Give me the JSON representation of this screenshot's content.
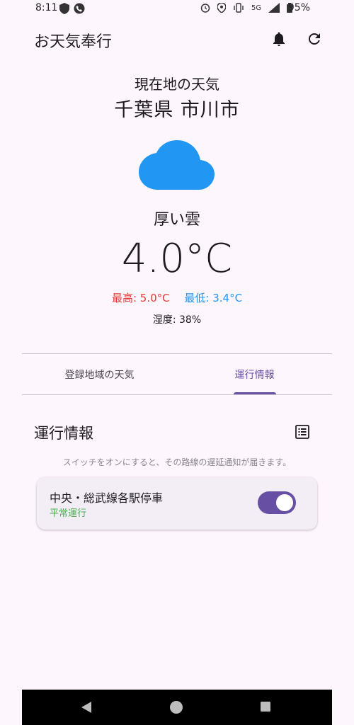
{
  "status_bar": {
    "time": "8:11",
    "network": "5G",
    "battery": "95%",
    "icons": [
      "shield-icon",
      "phone-icon",
      "alarm-icon",
      "location-icon",
      "vibrate-icon",
      "signal-icon",
      "battery-icon"
    ]
  },
  "app_bar": {
    "title": "お天気奉行",
    "icons": [
      "bell-icon",
      "refresh-icon"
    ]
  },
  "weather": {
    "location_label": "現在地の天気",
    "location": "千葉県 市川市",
    "condition": "厚い雲",
    "temperature": "4.0°C",
    "high": "最高: 5.0°C",
    "low": "最低: 3.4°C",
    "humidity": "湿度: 38%",
    "colors": {
      "high": "#e53935",
      "low": "#2196f3",
      "cloud": "#2196f3"
    }
  },
  "tabs": [
    {
      "label": "登録地域の天気",
      "selected": false
    },
    {
      "label": "運行情報",
      "selected": true
    }
  ],
  "service": {
    "title": "運行情報",
    "hint": "スイッチをオンにすると、その路線の遅延通知が届きます。",
    "lines": [
      {
        "name": "中央・総武線各駅停車",
        "status": "平常運行",
        "notify": true
      }
    ]
  },
  "colors": {
    "accent": "#6750a4",
    "status_ok": "#4caf50",
    "background": "#fdf6fc"
  }
}
